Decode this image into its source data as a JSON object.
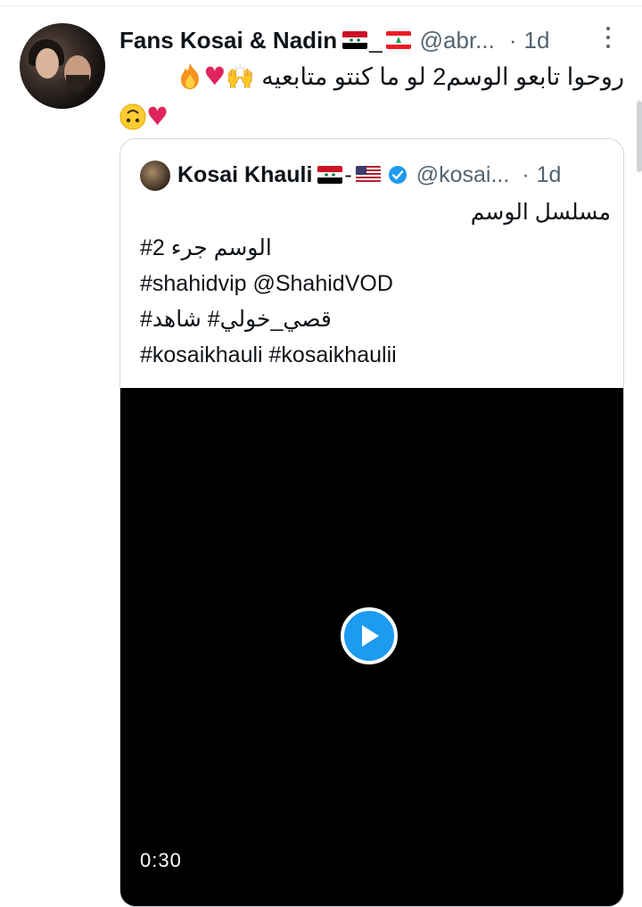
{
  "tweet": {
    "author_name": "Fans Kosai & Nadin",
    "separator": "_",
    "handle": "@abr...",
    "dot": "·",
    "time": "1d",
    "text_line1": "روحوا تابعو الوسم2 لو ما كنتو متابعيه",
    "emojis_line1": [
      "raising-hands",
      "heart",
      "fire"
    ],
    "emojis_line2": [
      "upside-down-face",
      "heart"
    ]
  },
  "quote": {
    "author_name": "Kosai Khauli",
    "separator": "-",
    "handle": "@kosai...",
    "dot": "·",
    "time": "1d",
    "lines": [
      "مسلسل الوسم",
      "الوسم  جرء 2#",
      "#shahidvip @ShahidVOD",
      "قصي_خولي# شاهد#",
      "#kosaikhauli #kosaikhaulii"
    ],
    "video": {
      "duration": "0:30"
    }
  },
  "colors": {
    "accent": "#1d9bf0",
    "heart": "#e0245e",
    "secondary_text": "#536471",
    "border": "#cfd9de"
  }
}
